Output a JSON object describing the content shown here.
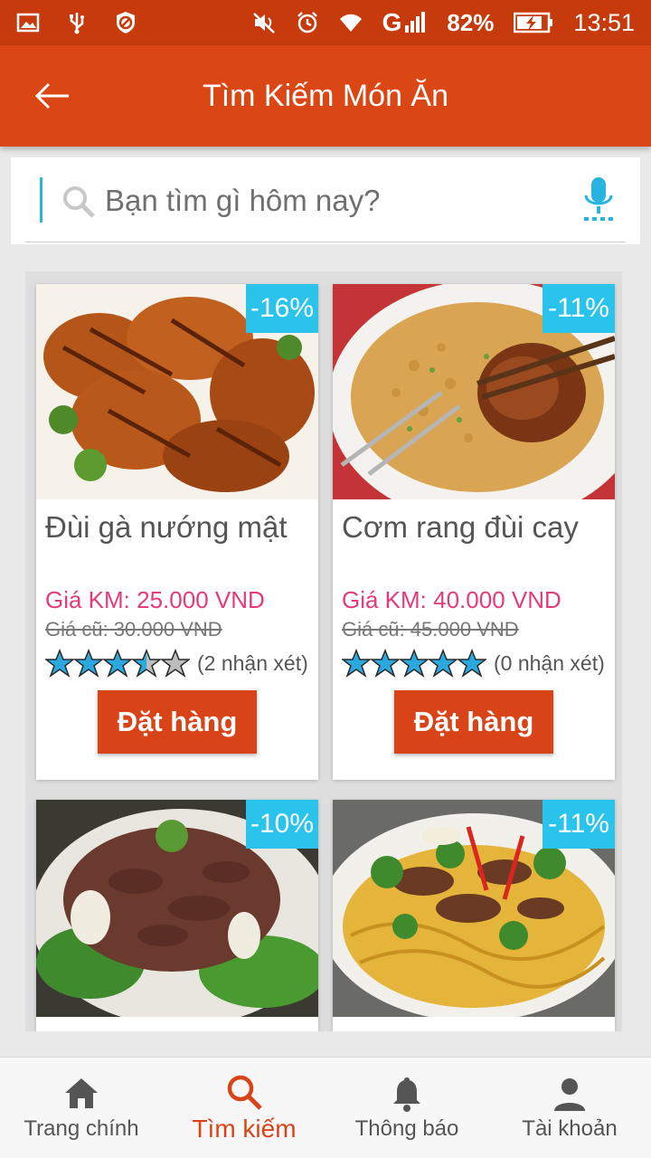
{
  "status_bar": {
    "battery": "82%",
    "time": "13:51",
    "network": "G"
  },
  "app_bar": {
    "title": "Tìm Kiếm Món Ăn"
  },
  "search": {
    "placeholder": "Bạn tìm gì hôm nay?"
  },
  "products": [
    {
      "discount": "-16%",
      "name": "Đùi gà nướng mật",
      "price_new": "Giá KM: 25.000 VND",
      "price_old": "Giá cũ: 30.000 VND",
      "rating": 3.5,
      "reviews": "(2 nhận xét)",
      "order_label": "Đặt hàng",
      "image": "grilled-chicken"
    },
    {
      "discount": "-11%",
      "name": "Cơm rang đùi cay",
      "price_new": "Giá KM: 40.000 VND",
      "price_old": "Giá cũ: 45.000 VND",
      "rating": 5,
      "reviews": "(0 nhận xét)",
      "order_label": "Đặt hàng",
      "image": "fried-rice-chicken"
    },
    {
      "discount": "-10%",
      "image": "beef-greens"
    },
    {
      "discount": "-11%",
      "image": "beef-noodles"
    }
  ],
  "bottom_nav": [
    {
      "label": "Trang chính",
      "icon": "home-icon",
      "active": false
    },
    {
      "label": "Tìm kiếm",
      "icon": "search-icon",
      "active": true
    },
    {
      "label": "Thông báo",
      "icon": "bell-icon",
      "active": false
    },
    {
      "label": "Tài khoản",
      "icon": "account-icon",
      "active": false
    }
  ],
  "colors": {
    "primary": "#db4615",
    "status_bar": "#c63a0c",
    "badge": "#29c3ec",
    "price_new": "#e43b7b",
    "star_fill": "#29a9e0"
  }
}
